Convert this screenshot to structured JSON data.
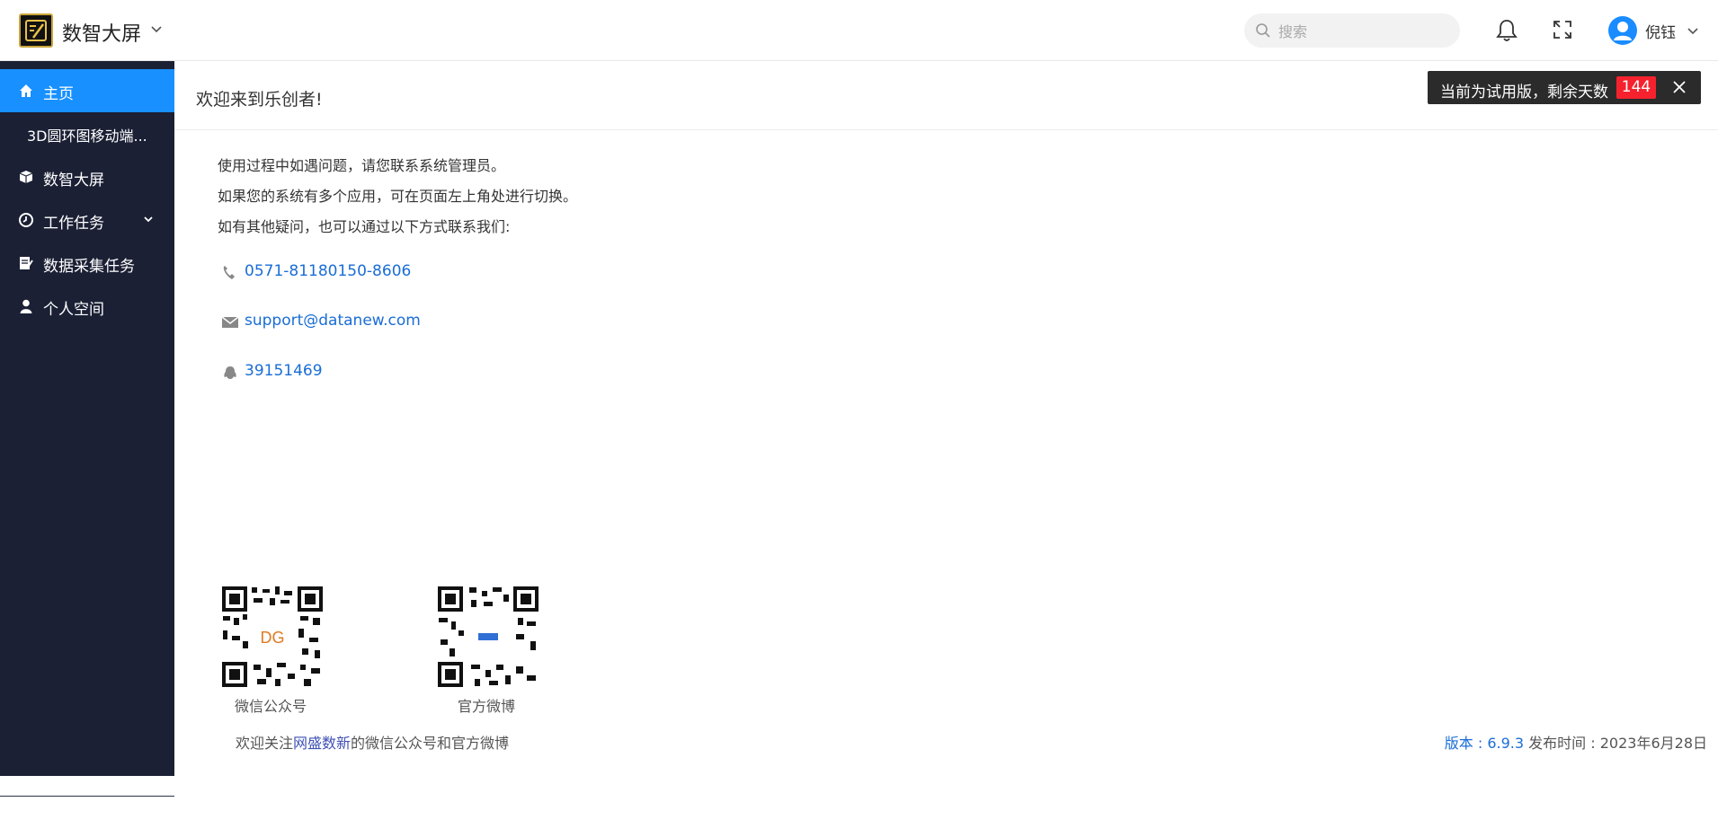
{
  "header": {
    "app_name": "数智大屏",
    "search_placeholder": "搜索",
    "username": "倪钰"
  },
  "sidebar": {
    "items": [
      {
        "label": "主页",
        "icon": "home-icon",
        "active": true
      },
      {
        "label": "3D圆环图移动端...",
        "icon": "",
        "active": false
      },
      {
        "label": "数智大屏",
        "icon": "cube-icon",
        "active": false
      },
      {
        "label": "工作任务",
        "icon": "clock-icon",
        "active": false,
        "expandable": true
      },
      {
        "label": "数据采集任务",
        "icon": "form-icon",
        "active": false
      },
      {
        "label": "个人空间",
        "icon": "user-icon",
        "active": false
      }
    ]
  },
  "main": {
    "welcome": "欢迎来到乐创者!",
    "trial_text": "当前为试用版，剩余天数",
    "trial_days": "144",
    "info_lines": [
      "使用过程中如遇问题，请您联系系统管理员。",
      "如果您的系统有多个应用，可在页面左上角处进行切换。",
      "如有其他疑问，也可以通过以下方式联系我们:"
    ],
    "contacts": [
      {
        "icon": "phone-icon",
        "text": "0571-81180150-8606"
      },
      {
        "icon": "mail-icon",
        "text": "support@datanew.com"
      },
      {
        "icon": "qq-icon",
        "text": "39151469"
      }
    ],
    "qr_codes": [
      {
        "caption": "微信公众号"
      },
      {
        "caption": "官方微博"
      }
    ],
    "follow_prefix": "欢迎关注",
    "follow_brand": "网盛数新",
    "follow_suffix": "的微信公众号和官方微博",
    "version_label": "版本 : 6.9.3",
    "release_label": "发布时间 : 2023年6月28日"
  },
  "colors": {
    "sidebar_bg": "#1b2035",
    "active": "#1890ff",
    "link": "#1a6dd6",
    "badge": "#f5222d"
  }
}
